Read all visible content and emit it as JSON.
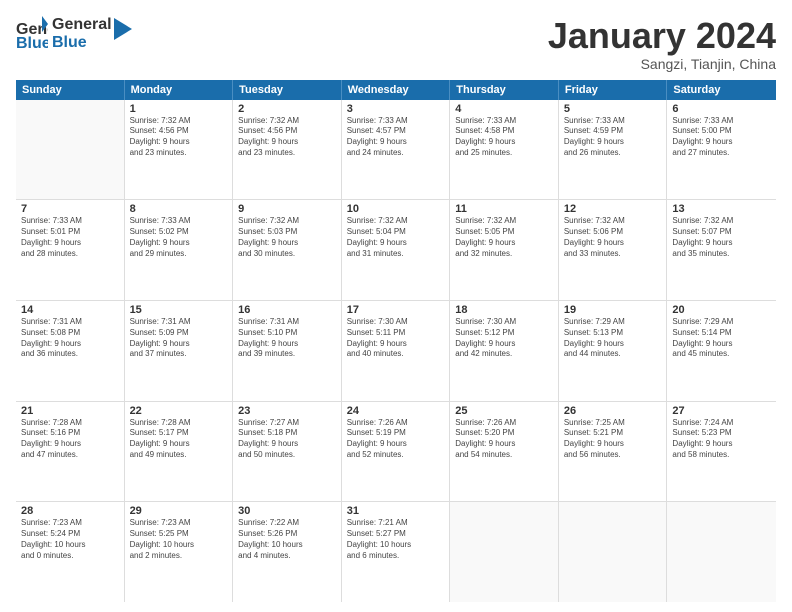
{
  "logo": {
    "line1": "General",
    "line2": "Blue"
  },
  "title": "January 2024",
  "location": "Sangzi, Tianjin, China",
  "days_header": [
    "Sunday",
    "Monday",
    "Tuesday",
    "Wednesday",
    "Thursday",
    "Friday",
    "Saturday"
  ],
  "weeks": [
    [
      {
        "num": "",
        "sunrise": "",
        "sunset": "",
        "daylight": ""
      },
      {
        "num": "1",
        "sunrise": "7:32 AM",
        "sunset": "4:56 PM",
        "daylight": "9 hours and 23 minutes."
      },
      {
        "num": "2",
        "sunrise": "7:32 AM",
        "sunset": "4:56 PM",
        "daylight": "9 hours and 23 minutes."
      },
      {
        "num": "3",
        "sunrise": "7:33 AM",
        "sunset": "4:57 PM",
        "daylight": "9 hours and 24 minutes."
      },
      {
        "num": "4",
        "sunrise": "7:33 AM",
        "sunset": "4:58 PM",
        "daylight": "9 hours and 25 minutes."
      },
      {
        "num": "5",
        "sunrise": "7:33 AM",
        "sunset": "4:59 PM",
        "daylight": "9 hours and 26 minutes."
      },
      {
        "num": "6",
        "sunrise": "7:33 AM",
        "sunset": "5:00 PM",
        "daylight": "9 hours and 27 minutes."
      }
    ],
    [
      {
        "num": "7",
        "sunrise": "7:33 AM",
        "sunset": "5:01 PM",
        "daylight": "9 hours and 28 minutes."
      },
      {
        "num": "8",
        "sunrise": "7:33 AM",
        "sunset": "5:02 PM",
        "daylight": "9 hours and 29 minutes."
      },
      {
        "num": "9",
        "sunrise": "7:32 AM",
        "sunset": "5:03 PM",
        "daylight": "9 hours and 30 minutes."
      },
      {
        "num": "10",
        "sunrise": "7:32 AM",
        "sunset": "5:04 PM",
        "daylight": "9 hours and 31 minutes."
      },
      {
        "num": "11",
        "sunrise": "7:32 AM",
        "sunset": "5:05 PM",
        "daylight": "9 hours and 32 minutes."
      },
      {
        "num": "12",
        "sunrise": "7:32 AM",
        "sunset": "5:06 PM",
        "daylight": "9 hours and 33 minutes."
      },
      {
        "num": "13",
        "sunrise": "7:32 AM",
        "sunset": "5:07 PM",
        "daylight": "9 hours and 35 minutes."
      }
    ],
    [
      {
        "num": "14",
        "sunrise": "7:31 AM",
        "sunset": "5:08 PM",
        "daylight": "9 hours and 36 minutes."
      },
      {
        "num": "15",
        "sunrise": "7:31 AM",
        "sunset": "5:09 PM",
        "daylight": "9 hours and 37 minutes."
      },
      {
        "num": "16",
        "sunrise": "7:31 AM",
        "sunset": "5:10 PM",
        "daylight": "9 hours and 39 minutes."
      },
      {
        "num": "17",
        "sunrise": "7:30 AM",
        "sunset": "5:11 PM",
        "daylight": "9 hours and 40 minutes."
      },
      {
        "num": "18",
        "sunrise": "7:30 AM",
        "sunset": "5:12 PM",
        "daylight": "9 hours and 42 minutes."
      },
      {
        "num": "19",
        "sunrise": "7:29 AM",
        "sunset": "5:13 PM",
        "daylight": "9 hours and 44 minutes."
      },
      {
        "num": "20",
        "sunrise": "7:29 AM",
        "sunset": "5:14 PM",
        "daylight": "9 hours and 45 minutes."
      }
    ],
    [
      {
        "num": "21",
        "sunrise": "7:28 AM",
        "sunset": "5:16 PM",
        "daylight": "9 hours and 47 minutes."
      },
      {
        "num": "22",
        "sunrise": "7:28 AM",
        "sunset": "5:17 PM",
        "daylight": "9 hours and 49 minutes."
      },
      {
        "num": "23",
        "sunrise": "7:27 AM",
        "sunset": "5:18 PM",
        "daylight": "9 hours and 50 minutes."
      },
      {
        "num": "24",
        "sunrise": "7:26 AM",
        "sunset": "5:19 PM",
        "daylight": "9 hours and 52 minutes."
      },
      {
        "num": "25",
        "sunrise": "7:26 AM",
        "sunset": "5:20 PM",
        "daylight": "9 hours and 54 minutes."
      },
      {
        "num": "26",
        "sunrise": "7:25 AM",
        "sunset": "5:21 PM",
        "daylight": "9 hours and 56 minutes."
      },
      {
        "num": "27",
        "sunrise": "7:24 AM",
        "sunset": "5:23 PM",
        "daylight": "9 hours and 58 minutes."
      }
    ],
    [
      {
        "num": "28",
        "sunrise": "7:23 AM",
        "sunset": "5:24 PM",
        "daylight": "10 hours and 0 minutes."
      },
      {
        "num": "29",
        "sunrise": "7:23 AM",
        "sunset": "5:25 PM",
        "daylight": "10 hours and 2 minutes."
      },
      {
        "num": "30",
        "sunrise": "7:22 AM",
        "sunset": "5:26 PM",
        "daylight": "10 hours and 4 minutes."
      },
      {
        "num": "31",
        "sunrise": "7:21 AM",
        "sunset": "5:27 PM",
        "daylight": "10 hours and 6 minutes."
      },
      {
        "num": "",
        "sunrise": "",
        "sunset": "",
        "daylight": ""
      },
      {
        "num": "",
        "sunrise": "",
        "sunset": "",
        "daylight": ""
      },
      {
        "num": "",
        "sunrise": "",
        "sunset": "",
        "daylight": ""
      }
    ]
  ]
}
